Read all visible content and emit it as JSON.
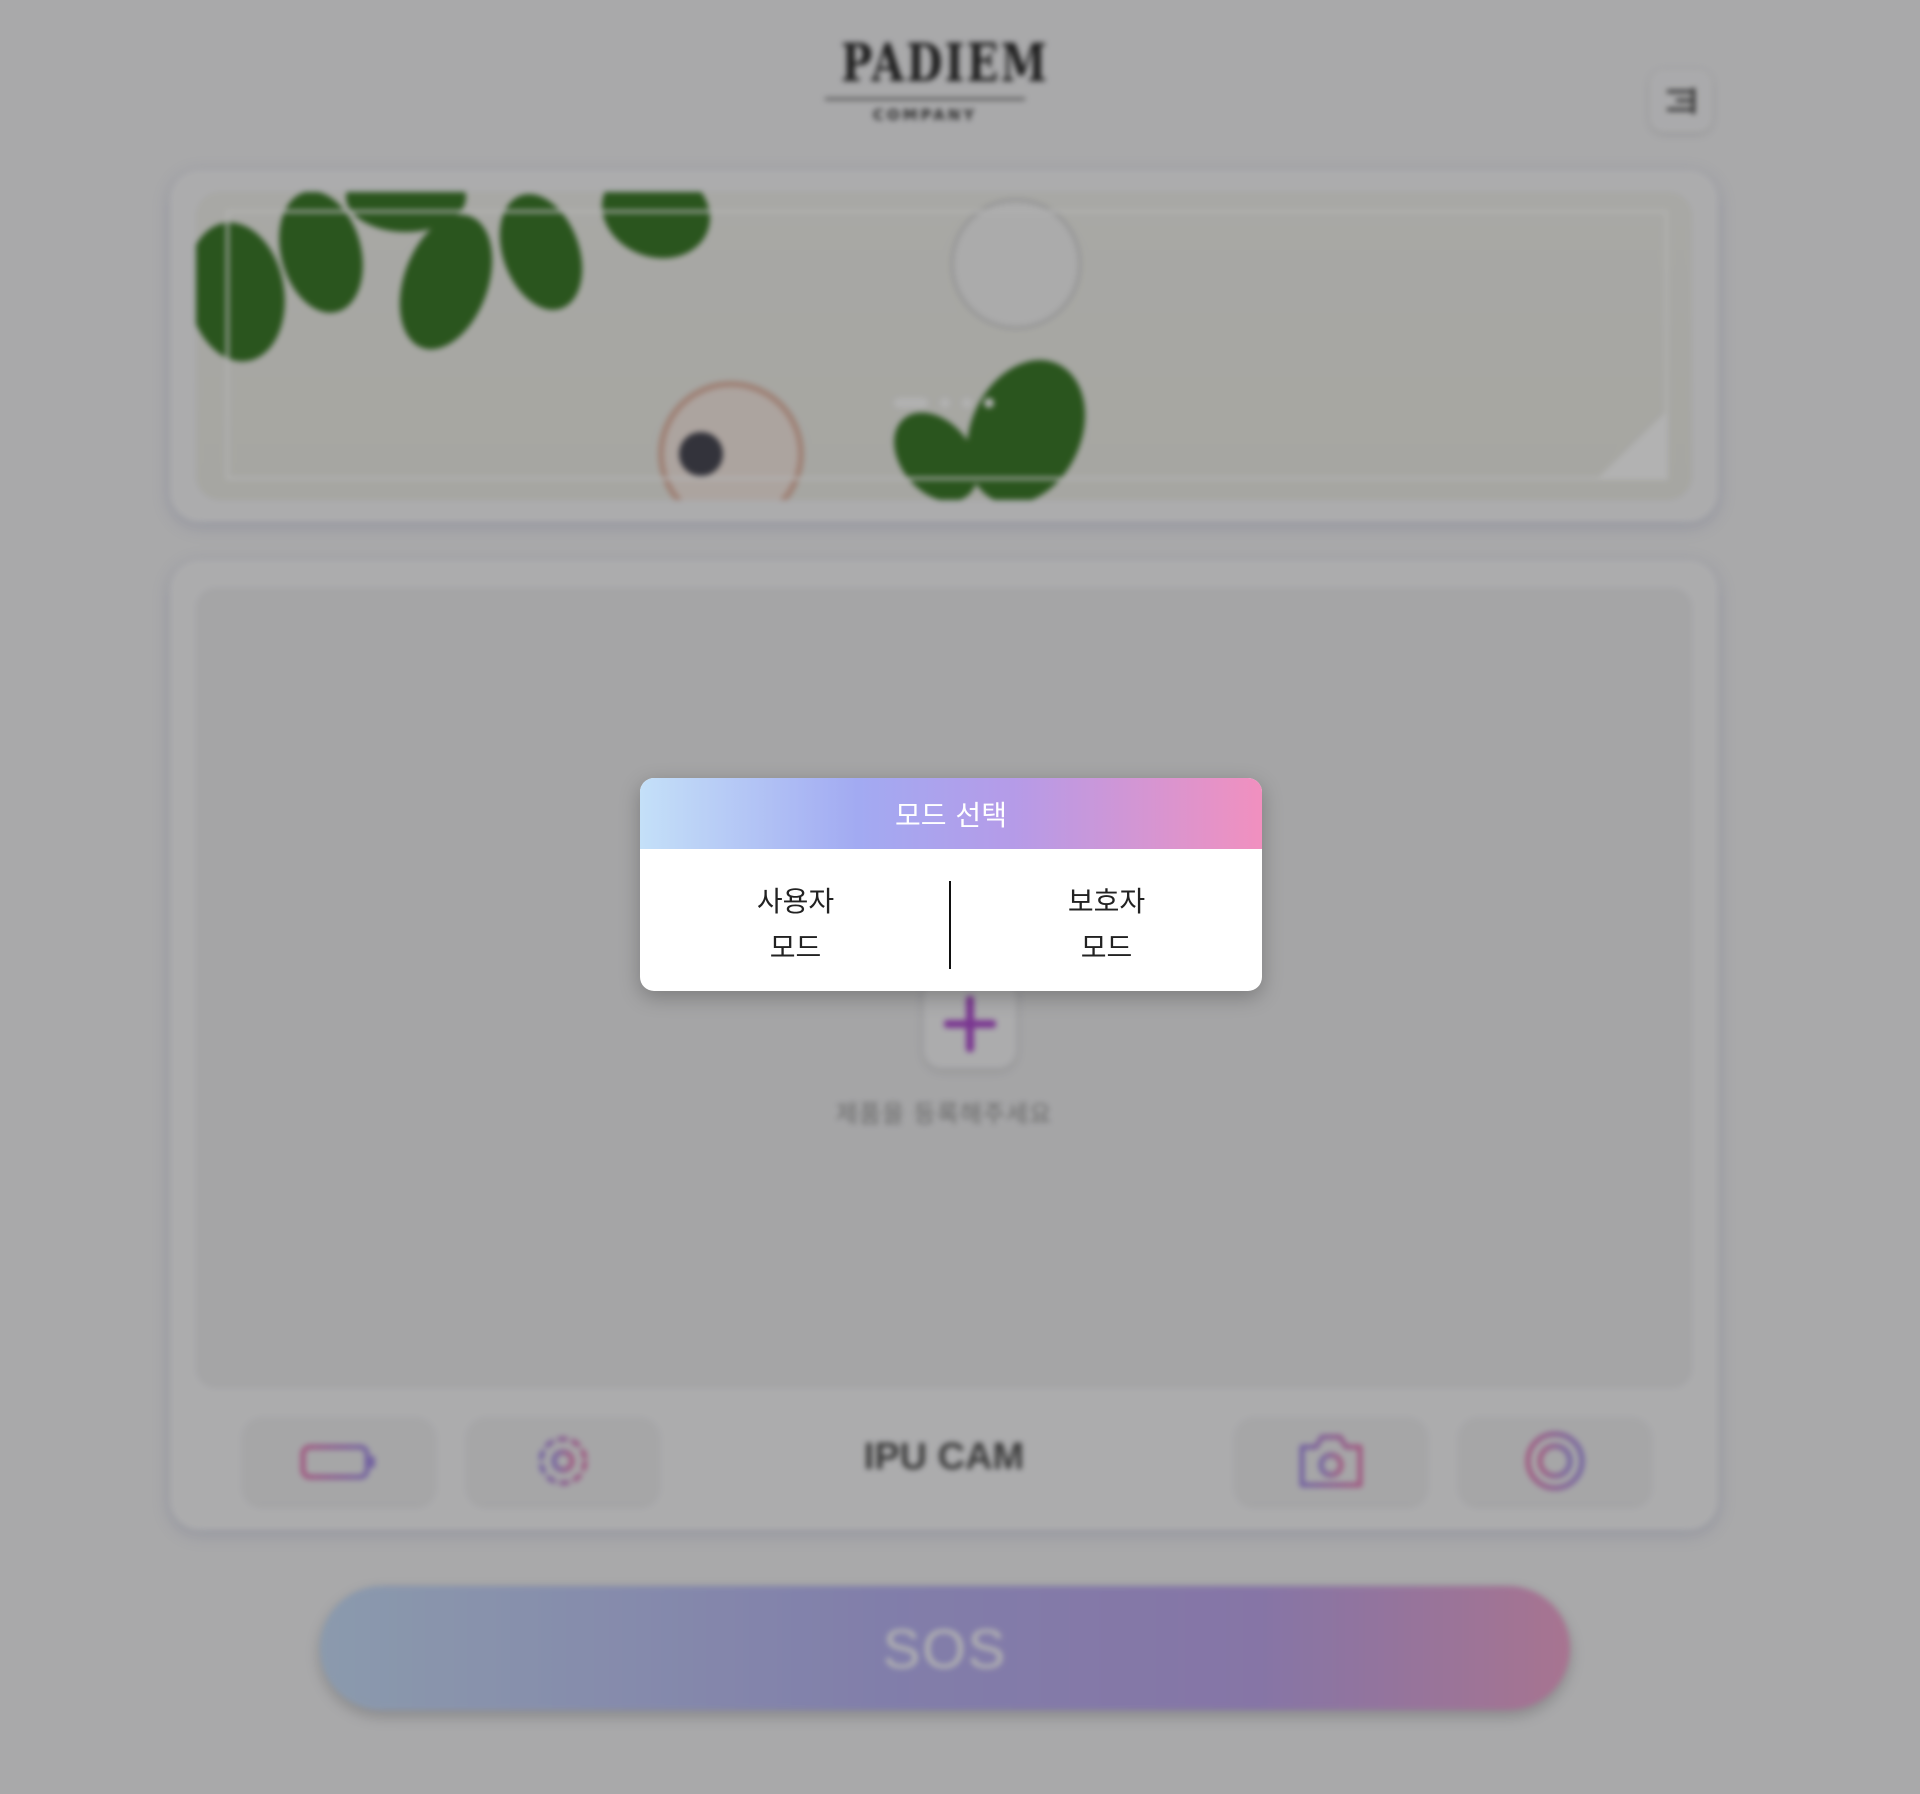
{
  "header": {
    "logo_main": "PADIEM",
    "logo_sub": "COMPANY",
    "menu_icon": "menu-icon"
  },
  "banner": {
    "slide_count": 4,
    "active_slide": 1
  },
  "main": {
    "add_hint": "제품을 등록해주세요",
    "camera_title": "IPU CAM",
    "tools": [
      {
        "name": "battery-icon"
      },
      {
        "name": "gear-icon"
      },
      {
        "name": "camera-icon"
      },
      {
        "name": "record-icon"
      }
    ]
  },
  "sos": {
    "label": "SOS"
  },
  "modal": {
    "title": "모드 선택",
    "user_mode": [
      "사용자",
      "모드"
    ],
    "guardian_mode": [
      "보호자",
      "모드"
    ]
  },
  "colors": {
    "accent_pink": "#e67fb9",
    "accent_purple": "#a68ee6",
    "accent_blue": "#c4e0f8"
  }
}
